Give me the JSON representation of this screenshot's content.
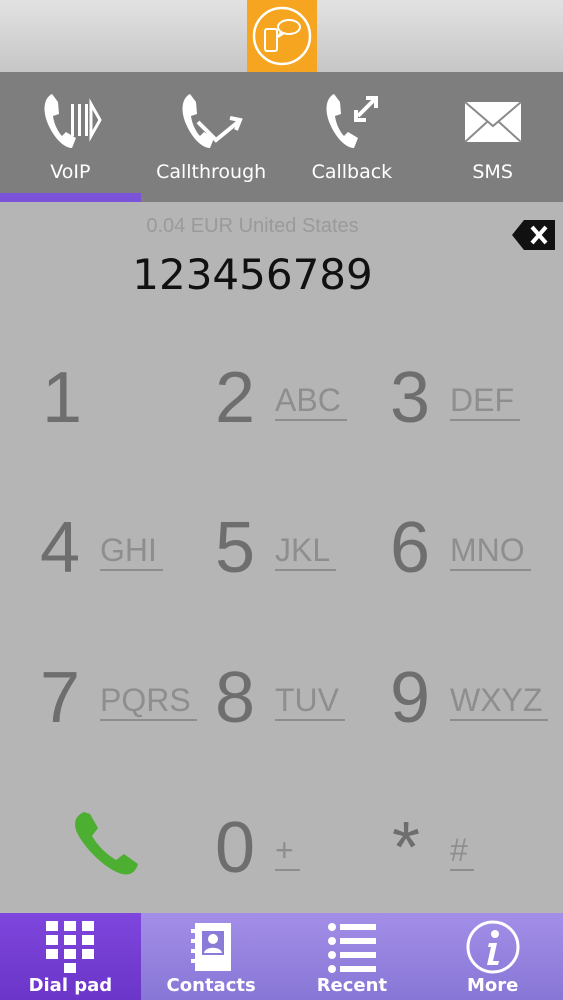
{
  "modes": [
    {
      "label": "VoIP",
      "icon": "voip-phone-icon",
      "active": true
    },
    {
      "label": "Callthrough",
      "icon": "callthrough-phone-icon",
      "active": false
    },
    {
      "label": "Callback",
      "icon": "callback-phone-icon",
      "active": false
    },
    {
      "label": "SMS",
      "icon": "envelope-icon",
      "active": false
    }
  ],
  "rate": "0.04 EUR United States",
  "dialed_number": "123456789",
  "keys": [
    {
      "digit": "1",
      "letters": ""
    },
    {
      "digit": "2",
      "letters": "ABC"
    },
    {
      "digit": "3",
      "letters": "DEF"
    },
    {
      "digit": "4",
      "letters": "GHI"
    },
    {
      "digit": "5",
      "letters": "JKL"
    },
    {
      "digit": "6",
      "letters": "MNO"
    },
    {
      "digit": "7",
      "letters": "PQRS"
    },
    {
      "digit": "8",
      "letters": "TUV"
    },
    {
      "digit": "9",
      "letters": "WXYZ"
    },
    {
      "digit": "0",
      "letters": "+"
    },
    {
      "digit": "*",
      "letters": "#"
    }
  ],
  "tabs": [
    {
      "label": "Dial pad",
      "icon": "dialpad-icon",
      "active": true
    },
    {
      "label": "Contacts",
      "icon": "contacts-book-icon",
      "active": false
    },
    {
      "label": "Recent",
      "icon": "list-icon",
      "active": false
    },
    {
      "label": "More",
      "icon": "info-icon",
      "active": false
    }
  ],
  "colors": {
    "accent": "#7a53d9",
    "logo": "#f5a51f",
    "call": "#4caf32"
  }
}
